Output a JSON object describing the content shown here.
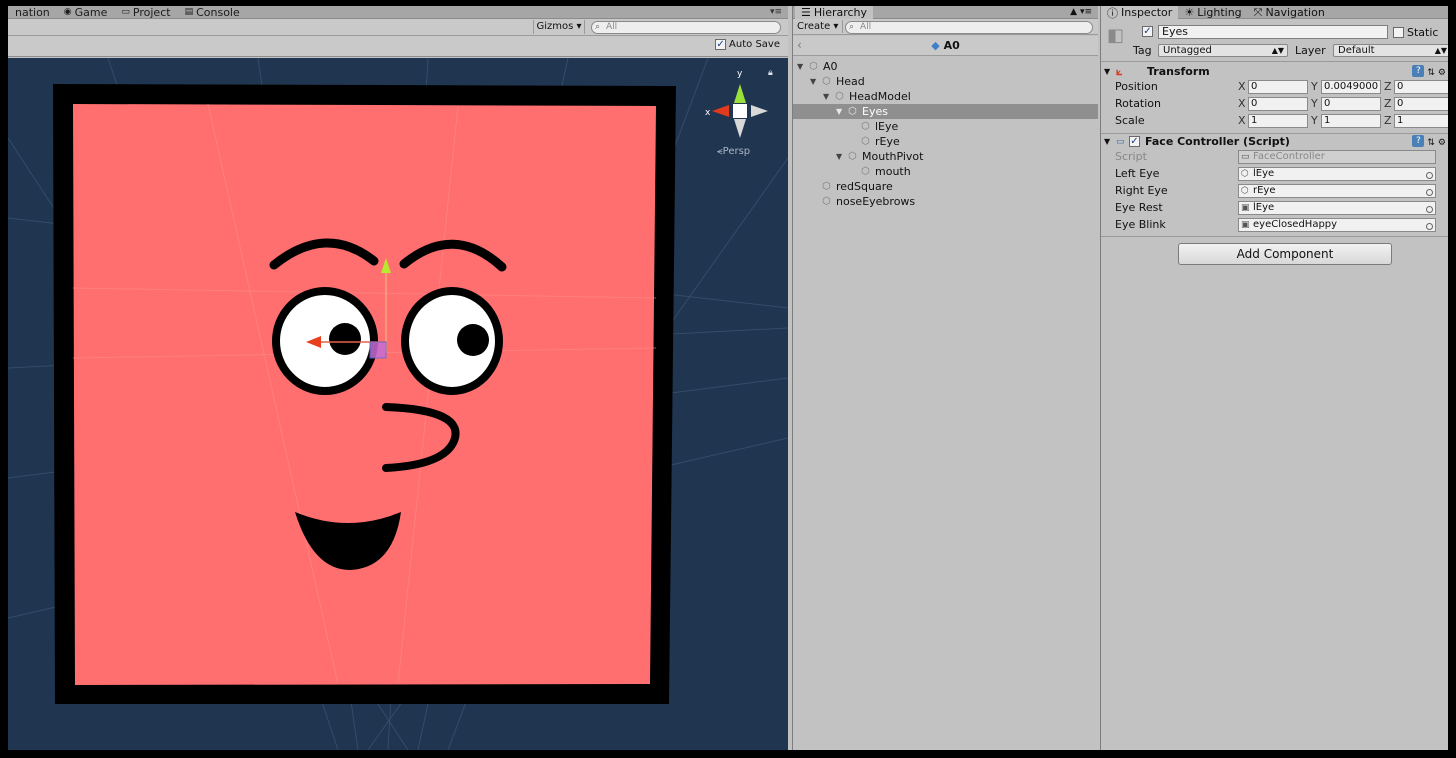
{
  "scene_tabs": {
    "animation": "nation",
    "game": "Game",
    "project": "Project",
    "console": "Console"
  },
  "scene_toolbar": {
    "gizmos": "Gizmos",
    "search_placeholder": "All",
    "auto_save": "Auto Save",
    "auto_save_checked": true
  },
  "viewport": {
    "persp_label": "Persp",
    "axis_x": "x",
    "axis_y": "y",
    "colors": {
      "background": "#1f3550",
      "face": "#ff6f6f",
      "border": "#000000"
    }
  },
  "hierarchy": {
    "tab": "Hierarchy",
    "create": "Create",
    "search_placeholder": "All",
    "scene_name": "A0",
    "items": [
      {
        "label": "A0",
        "depth": 0,
        "expanded": true,
        "selected": false
      },
      {
        "label": "Head",
        "depth": 1,
        "expanded": true,
        "selected": false
      },
      {
        "label": "HeadModel",
        "depth": 2,
        "expanded": true,
        "selected": false
      },
      {
        "label": "Eyes",
        "depth": 3,
        "expanded": true,
        "selected": true
      },
      {
        "label": "lEye",
        "depth": 4,
        "expanded": null,
        "selected": false
      },
      {
        "label": "rEye",
        "depth": 4,
        "expanded": null,
        "selected": false
      },
      {
        "label": "MouthPivot",
        "depth": 3,
        "expanded": true,
        "selected": false
      },
      {
        "label": "mouth",
        "depth": 4,
        "expanded": null,
        "selected": false
      },
      {
        "label": "redSquare",
        "depth": 1,
        "expanded": null,
        "selected": false
      },
      {
        "label": "noseEyebrows",
        "depth": 1,
        "expanded": null,
        "selected": false
      }
    ]
  },
  "inspector": {
    "tabs": [
      "Inspector",
      "Lighting",
      "Navigation"
    ],
    "object_name": "Eyes",
    "static_label": "Static",
    "tag_label": "Tag",
    "tag_value": "Untagged",
    "layer_label": "Layer",
    "layer_value": "Default",
    "transform": {
      "title": "Transform",
      "rows": [
        {
          "label": "Position",
          "x": "0",
          "y": "0.0049000",
          "z": "0"
        },
        {
          "label": "Rotation",
          "x": "0",
          "y": "0",
          "z": "0"
        },
        {
          "label": "Scale",
          "x": "1",
          "y": "1",
          "z": "1"
        }
      ]
    },
    "face_controller": {
      "title": "Face Controller (Script)",
      "script_label": "Script",
      "script_value": "FaceController",
      "fields": [
        {
          "label": "Left Eye",
          "value": "lEye",
          "kind": "gameobject"
        },
        {
          "label": "Right Eye",
          "value": "rEye",
          "kind": "gameobject"
        },
        {
          "label": "Eye Rest",
          "value": "lEye",
          "kind": "sprite"
        },
        {
          "label": "Eye Blink",
          "value": "eyeClosedHappy",
          "kind": "sprite"
        }
      ]
    },
    "add_component": "Add Component"
  }
}
